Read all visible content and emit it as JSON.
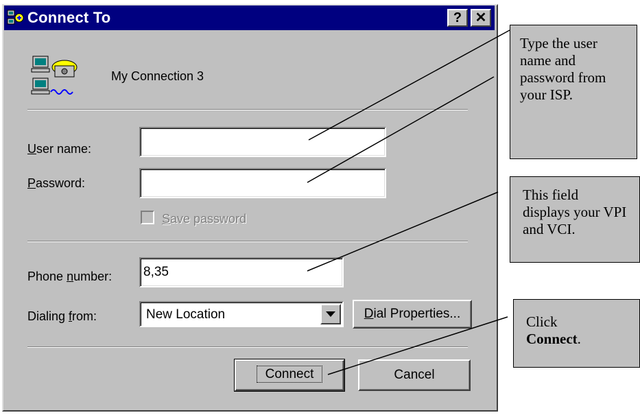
{
  "dialog": {
    "title": "Connect To",
    "help_label": "?",
    "close_label": "✕",
    "title_icon": "dialup-networking-icon",
    "connection_icon": "dialup-connection-icon",
    "connection_name": "My Connection 3"
  },
  "form": {
    "username_label": "User name:",
    "username_value": "",
    "password_label": "Password:",
    "password_value": "",
    "save_password_label": "Save password",
    "save_password_checked": false,
    "phone_label": "Phone number:",
    "phone_value": "8,35",
    "dialing_label": "Dialing from:",
    "dialing_value": "New Location",
    "dial_properties_label": "Dial Properties...",
    "connect_label": "Connect",
    "cancel_label": "Cancel"
  },
  "callouts": {
    "c1": "Type the user name and password from your ISP.",
    "c2": "This field displays your VPI and VCI.",
    "c3_prefix": "Click",
    "c3_bold": "Connect",
    "c3_suffix": "."
  }
}
